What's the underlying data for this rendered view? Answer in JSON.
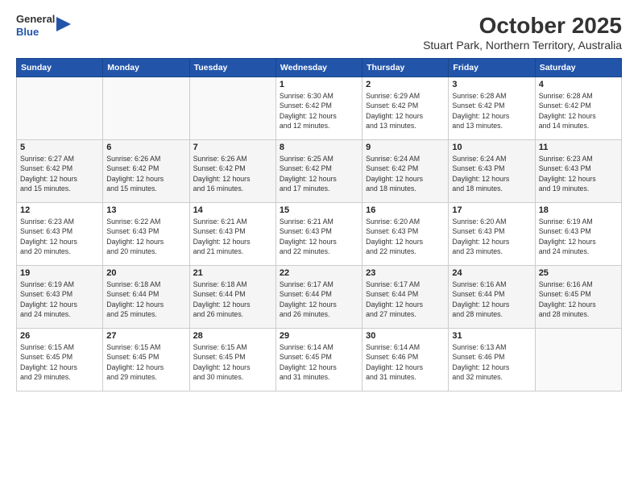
{
  "logo": {
    "general": "General",
    "blue": "Blue"
  },
  "title": "October 2025",
  "subtitle": "Stuart Park, Northern Territory, Australia",
  "days_header": [
    "Sunday",
    "Monday",
    "Tuesday",
    "Wednesday",
    "Thursday",
    "Friday",
    "Saturday"
  ],
  "weeks": [
    [
      {
        "day": "",
        "info": ""
      },
      {
        "day": "",
        "info": ""
      },
      {
        "day": "",
        "info": ""
      },
      {
        "day": "1",
        "info": "Sunrise: 6:30 AM\nSunset: 6:42 PM\nDaylight: 12 hours\nand 12 minutes."
      },
      {
        "day": "2",
        "info": "Sunrise: 6:29 AM\nSunset: 6:42 PM\nDaylight: 12 hours\nand 13 minutes."
      },
      {
        "day": "3",
        "info": "Sunrise: 6:28 AM\nSunset: 6:42 PM\nDaylight: 12 hours\nand 13 minutes."
      },
      {
        "day": "4",
        "info": "Sunrise: 6:28 AM\nSunset: 6:42 PM\nDaylight: 12 hours\nand 14 minutes."
      }
    ],
    [
      {
        "day": "5",
        "info": "Sunrise: 6:27 AM\nSunset: 6:42 PM\nDaylight: 12 hours\nand 15 minutes."
      },
      {
        "day": "6",
        "info": "Sunrise: 6:26 AM\nSunset: 6:42 PM\nDaylight: 12 hours\nand 15 minutes."
      },
      {
        "day": "7",
        "info": "Sunrise: 6:26 AM\nSunset: 6:42 PM\nDaylight: 12 hours\nand 16 minutes."
      },
      {
        "day": "8",
        "info": "Sunrise: 6:25 AM\nSunset: 6:42 PM\nDaylight: 12 hours\nand 17 minutes."
      },
      {
        "day": "9",
        "info": "Sunrise: 6:24 AM\nSunset: 6:42 PM\nDaylight: 12 hours\nand 18 minutes."
      },
      {
        "day": "10",
        "info": "Sunrise: 6:24 AM\nSunset: 6:43 PM\nDaylight: 12 hours\nand 18 minutes."
      },
      {
        "day": "11",
        "info": "Sunrise: 6:23 AM\nSunset: 6:43 PM\nDaylight: 12 hours\nand 19 minutes."
      }
    ],
    [
      {
        "day": "12",
        "info": "Sunrise: 6:23 AM\nSunset: 6:43 PM\nDaylight: 12 hours\nand 20 minutes."
      },
      {
        "day": "13",
        "info": "Sunrise: 6:22 AM\nSunset: 6:43 PM\nDaylight: 12 hours\nand 20 minutes."
      },
      {
        "day": "14",
        "info": "Sunrise: 6:21 AM\nSunset: 6:43 PM\nDaylight: 12 hours\nand 21 minutes."
      },
      {
        "day": "15",
        "info": "Sunrise: 6:21 AM\nSunset: 6:43 PM\nDaylight: 12 hours\nand 22 minutes."
      },
      {
        "day": "16",
        "info": "Sunrise: 6:20 AM\nSunset: 6:43 PM\nDaylight: 12 hours\nand 22 minutes."
      },
      {
        "day": "17",
        "info": "Sunrise: 6:20 AM\nSunset: 6:43 PM\nDaylight: 12 hours\nand 23 minutes."
      },
      {
        "day": "18",
        "info": "Sunrise: 6:19 AM\nSunset: 6:43 PM\nDaylight: 12 hours\nand 24 minutes."
      }
    ],
    [
      {
        "day": "19",
        "info": "Sunrise: 6:19 AM\nSunset: 6:43 PM\nDaylight: 12 hours\nand 24 minutes."
      },
      {
        "day": "20",
        "info": "Sunrise: 6:18 AM\nSunset: 6:44 PM\nDaylight: 12 hours\nand 25 minutes."
      },
      {
        "day": "21",
        "info": "Sunrise: 6:18 AM\nSunset: 6:44 PM\nDaylight: 12 hours\nand 26 minutes."
      },
      {
        "day": "22",
        "info": "Sunrise: 6:17 AM\nSunset: 6:44 PM\nDaylight: 12 hours\nand 26 minutes."
      },
      {
        "day": "23",
        "info": "Sunrise: 6:17 AM\nSunset: 6:44 PM\nDaylight: 12 hours\nand 27 minutes."
      },
      {
        "day": "24",
        "info": "Sunrise: 6:16 AM\nSunset: 6:44 PM\nDaylight: 12 hours\nand 28 minutes."
      },
      {
        "day": "25",
        "info": "Sunrise: 6:16 AM\nSunset: 6:45 PM\nDaylight: 12 hours\nand 28 minutes."
      }
    ],
    [
      {
        "day": "26",
        "info": "Sunrise: 6:15 AM\nSunset: 6:45 PM\nDaylight: 12 hours\nand 29 minutes."
      },
      {
        "day": "27",
        "info": "Sunrise: 6:15 AM\nSunset: 6:45 PM\nDaylight: 12 hours\nand 29 minutes."
      },
      {
        "day": "28",
        "info": "Sunrise: 6:15 AM\nSunset: 6:45 PM\nDaylight: 12 hours\nand 30 minutes."
      },
      {
        "day": "29",
        "info": "Sunrise: 6:14 AM\nSunset: 6:45 PM\nDaylight: 12 hours\nand 31 minutes."
      },
      {
        "day": "30",
        "info": "Sunrise: 6:14 AM\nSunset: 6:46 PM\nDaylight: 12 hours\nand 31 minutes."
      },
      {
        "day": "31",
        "info": "Sunrise: 6:13 AM\nSunset: 6:46 PM\nDaylight: 12 hours\nand 32 minutes."
      },
      {
        "day": "",
        "info": ""
      }
    ]
  ]
}
